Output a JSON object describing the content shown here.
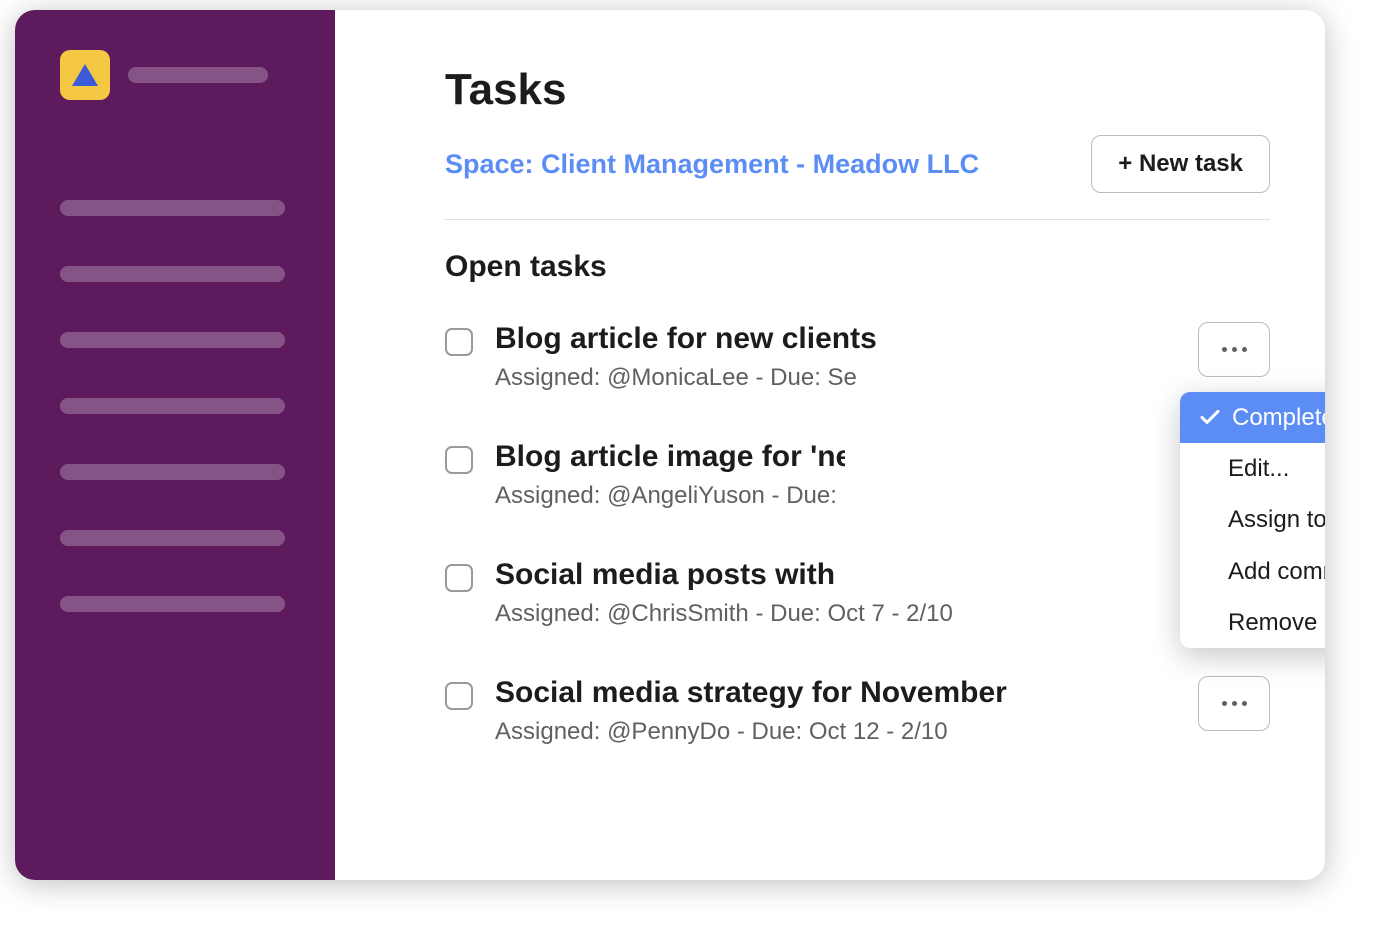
{
  "header": {
    "title": "Tasks",
    "breadcrumb": "Space: Client Management - Meadow LLC",
    "new_task_label": "+ New task"
  },
  "section_title": "Open tasks",
  "tasks": [
    {
      "title": "Blog article for new clients",
      "meta": "Assigned: @MonicaLee - Due: Se"
    },
    {
      "title": "Blog article image for 'new",
      "meta": "Assigned: @AngeliYuson - Due: S"
    },
    {
      "title": "Social media posts with H",
      "meta": "Assigned: @ChrisSmith - Due: Oct 7 - 2/10"
    },
    {
      "title": "Social media strategy for November",
      "meta": "Assigned: @PennyDo - Due: Oct 12 -  2/10"
    }
  ],
  "menu": {
    "complete": "Complete",
    "edit": "Edit...",
    "assign": "Assign to me",
    "comment": "Add comment",
    "remove": "Remove"
  }
}
